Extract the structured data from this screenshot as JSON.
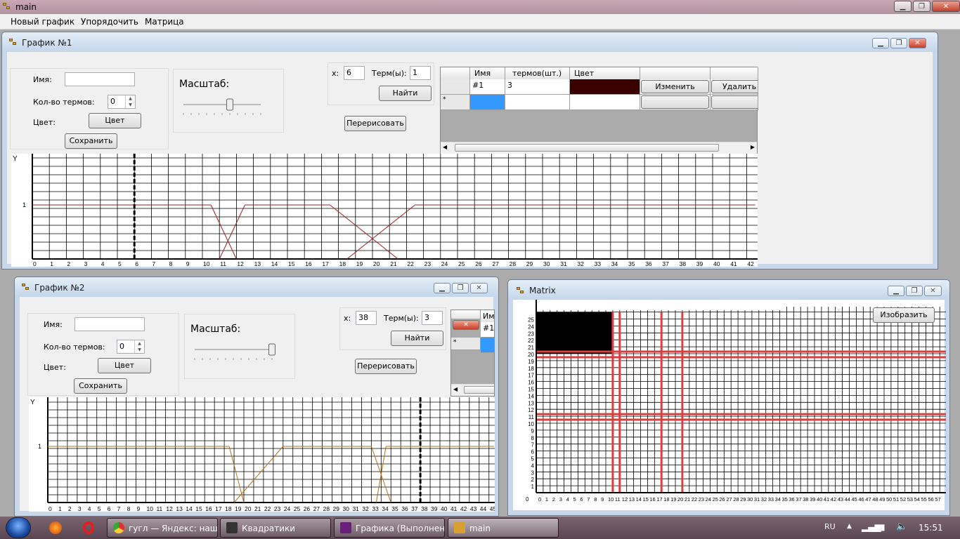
{
  "app": {
    "title": "main"
  },
  "menu": {
    "items": [
      "Новый график",
      "Упорядочить",
      "Матрица"
    ]
  },
  "win1": {
    "title": "График №1",
    "name_label": "Имя:",
    "name_value": "",
    "terms_label": "Кол-во термов:",
    "terms_value": "0",
    "color_label": "Цвет:",
    "color_button": "Цвет",
    "save_button": "Сохранить",
    "scale_label": "Масштаб:",
    "scale_level": 0.6,
    "x_label": "x:",
    "x_value": "6",
    "term_label": "Терм(ы):",
    "term_value": "1",
    "find_button": "Найти",
    "redraw_button": "Перерисовать",
    "table": {
      "headers": [
        "Имя",
        "Кол-во термов(шт.)",
        "Цвет"
      ],
      "headers_visible": [
        "Имя",
        "термов(шт.)",
        "Цвет"
      ],
      "rows": [
        {
          "name": "#1",
          "terms": "3",
          "color": "#3a0000",
          "edit": "Изменить",
          "delete": "Удалить"
        }
      ],
      "new_row_marker": "*"
    },
    "plot": {
      "y_label": "Y",
      "y_tick": "1",
      "x_ticks": [
        "0",
        "1",
        "2",
        "3",
        "4",
        "5",
        "6",
        "7",
        "8",
        "9",
        "10",
        "11",
        "12",
        "13",
        "14",
        "15",
        "16",
        "17",
        "18",
        "19",
        "20",
        "21",
        "22",
        "23",
        "24",
        "25",
        "26",
        "27",
        "28",
        "29",
        "30",
        "31",
        "32",
        "33",
        "34",
        "35",
        "36",
        "37",
        "38",
        "39",
        "40",
        "41",
        "42"
      ],
      "marker_x": 6,
      "line_color": "#9a2020"
    }
  },
  "win2": {
    "title": "График №2",
    "name_label": "Имя:",
    "name_value": "",
    "terms_label": "Кол-во термов:",
    "terms_value": "0",
    "color_label": "Цвет:",
    "color_button": "Цвет",
    "save_button": "Сохранить",
    "scale_label": "Масштаб:",
    "scale_level": 1.0,
    "x_label": "x:",
    "x_value": "38",
    "term_label": "Терм(ы):",
    "term_value": "3",
    "find_button": "Найти",
    "redraw_button": "Перерисовать",
    "table": {
      "header_partial": "Им",
      "row_name": "#1",
      "new_row_marker": "*"
    },
    "plot": {
      "y_label": "Y",
      "y_tick": "1",
      "x_ticks": [
        "0",
        "1",
        "2",
        "3",
        "4",
        "5",
        "6",
        "7",
        "8",
        "9",
        "10",
        "11",
        "12",
        "13",
        "14",
        "15",
        "16",
        "17",
        "18",
        "19",
        "20",
        "21",
        "22",
        "23",
        "24",
        "25",
        "26",
        "27",
        "28",
        "29",
        "30",
        "31",
        "32",
        "33",
        "34",
        "35",
        "36",
        "37",
        "38",
        "39",
        "40",
        "41",
        "42",
        "43",
        "44",
        "45"
      ],
      "marker_x": 38,
      "line_color": "#b0701a"
    }
  },
  "matrix": {
    "title": "Matrix",
    "draw_button": "Изобразить",
    "origin_label": "0",
    "y_ticks": [
      "1",
      "2",
      "3",
      "4",
      "5",
      "6",
      "7",
      "8",
      "9",
      "10",
      "11",
      "12",
      "13",
      "14",
      "15",
      "16",
      "17",
      "18",
      "19",
      "20",
      "21",
      "22",
      "23",
      "24",
      "25"
    ],
    "x_ticks": [
      "0",
      "1",
      "2",
      "3",
      "4",
      "5",
      "6",
      "7",
      "8",
      "9",
      "10",
      "11",
      "12",
      "13",
      "14",
      "15",
      "16",
      "17",
      "18",
      "19",
      "20",
      "21",
      "22",
      "23",
      "24",
      "25",
      "26",
      "27",
      "28",
      "29",
      "30",
      "31",
      "32",
      "33",
      "34",
      "35",
      "36",
      "37",
      "38",
      "39",
      "40",
      "41",
      "42",
      "43",
      "44",
      "45",
      "46",
      "47",
      "48",
      "49",
      "50",
      "51",
      "52",
      "53",
      "54",
      "55",
      "56",
      "57"
    ],
    "red_color": "#d84040"
  },
  "taskbar": {
    "items": [
      "гугл — Яндекс: наш…",
      "Квадратики",
      "Графика (Выполнен…",
      "main"
    ],
    "lang": "RU",
    "time": "15:51"
  }
}
